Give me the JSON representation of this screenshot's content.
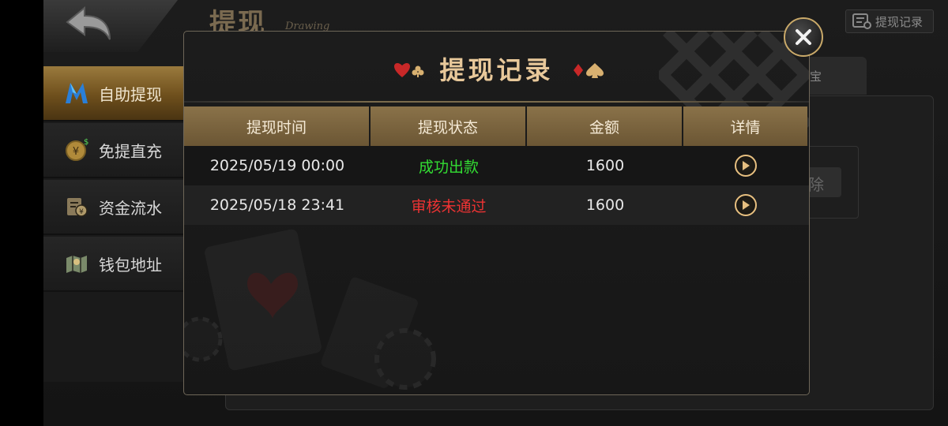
{
  "header": {
    "title": "提现",
    "subtitle": "Drawing",
    "records_button_label": "提现记录"
  },
  "sidebar": {
    "items": [
      {
        "label": "自助提现",
        "icon": "m-logo-icon",
        "active": true
      },
      {
        "label": "免提直充",
        "icon": "coin-icon",
        "active": false
      },
      {
        "label": "资金流水",
        "icon": "ledger-icon",
        "active": false
      },
      {
        "label": "钱包地址",
        "icon": "map-icon",
        "active": false
      }
    ]
  },
  "background": {
    "tab_fragment": "宝",
    "button_fragment": "除"
  },
  "modal": {
    "title": "提现记录",
    "columns": [
      "提现时间",
      "提现状态",
      "金额",
      "详情"
    ],
    "rows": [
      {
        "time": "2025/05/19 00:00",
        "status": "成功出款",
        "status_color": "#33dd33",
        "amount": "1600"
      },
      {
        "time": "2025/05/18 23:41",
        "status": "审核未通过",
        "status_color": "#ee3333",
        "amount": "1600"
      }
    ]
  },
  "colors": {
    "accent_gold": "#e8c89a",
    "header_brown": "#8a7249",
    "success": "#33dd33",
    "fail": "#ee3333"
  }
}
